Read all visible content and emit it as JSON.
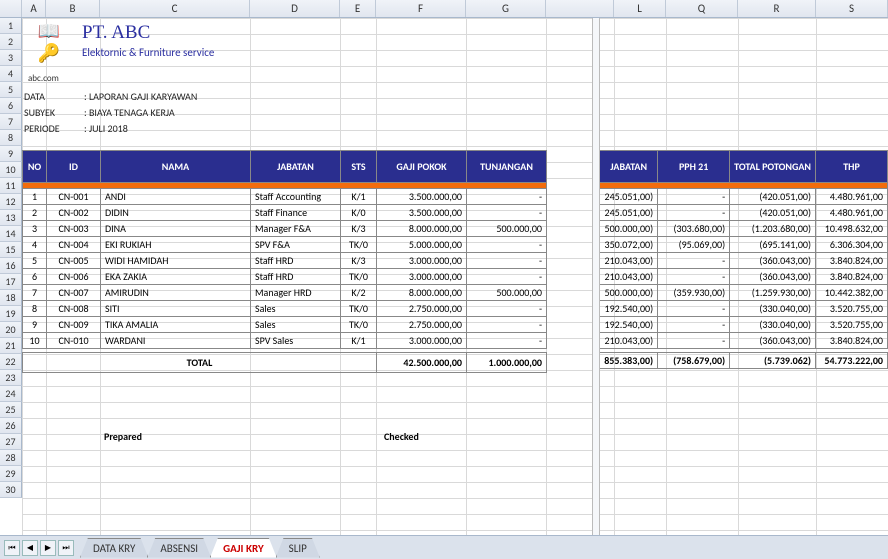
{
  "company": {
    "name": "PT. ABC",
    "tagline": "Elektornic & Furniture  service",
    "domain": "abc.com"
  },
  "meta": {
    "data_label": "DATA",
    "data_value": "LAPORAN GAJI KARYAWAN",
    "subyek_label": "SUBYEK",
    "subyek_value": "BIAYA TENAGA KERJA",
    "periode_label": "PERIODE",
    "periode_value": "JULI 2018"
  },
  "columns": [
    "NO",
    "ID",
    "NAMA",
    "JABATAN",
    "STS",
    "GAJI POKOK",
    "TUNJANGAN"
  ],
  "right_columns": [
    "JABATAN",
    "PPH 21",
    "TOTAL POTONGAN",
    "THP"
  ],
  "rows": [
    {
      "no": "1",
      "id": "CN-001",
      "nama": "ANDI",
      "jabatan": "Staff Accounting",
      "sts": "K/1",
      "gaji": "3.500.000,00",
      "tunj": "-",
      "jbt": "245.051,00)",
      "pph": "-",
      "pot": "(420.051,00)",
      "thp": "4.480.961,00"
    },
    {
      "no": "2",
      "id": "CN-002",
      "nama": "DIDIN",
      "jabatan": "Staff Finance",
      "sts": "K/0",
      "gaji": "3.500.000,00",
      "tunj": "-",
      "jbt": "245.051,00)",
      "pph": "-",
      "pot": "(420.051,00)",
      "thp": "4.480.961,00"
    },
    {
      "no": "3",
      "id": "CN-003",
      "nama": "DINA",
      "jabatan": "Manager F&A",
      "sts": "K/3",
      "gaji": "8.000.000,00",
      "tunj": "500.000,00",
      "jbt": "500.000,00)",
      "pph": "(303.680,00)",
      "pot": "(1.203.680,00)",
      "thp": "10.498.632,00"
    },
    {
      "no": "4",
      "id": "CN-004",
      "nama": "EKI RUKIAH",
      "jabatan": "SPV F&A",
      "sts": "TK/0",
      "gaji": "5.000.000,00",
      "tunj": "-",
      "jbt": "350.072,00)",
      "pph": "(95.069,00)",
      "pot": "(695.141,00)",
      "thp": "6.306.304,00"
    },
    {
      "no": "5",
      "id": "CN-005",
      "nama": "WIDI HAMIDAH",
      "jabatan": "Staff HRD",
      "sts": "K/3",
      "gaji": "3.000.000,00",
      "tunj": "-",
      "jbt": "210.043,00)",
      "pph": "-",
      "pot": "(360.043,00)",
      "thp": "3.840.824,00"
    },
    {
      "no": "6",
      "id": "CN-006",
      "nama": "EKA ZAKIA",
      "jabatan": "Staff HRD",
      "sts": "TK/0",
      "gaji": "3.000.000,00",
      "tunj": "-",
      "jbt": "210.043,00)",
      "pph": "-",
      "pot": "(360.043,00)",
      "thp": "3.840.824,00"
    },
    {
      "no": "7",
      "id": "CN-007",
      "nama": "AMIRUDIN",
      "jabatan": "Manager HRD",
      "sts": "K/2",
      "gaji": "8.000.000,00",
      "tunj": "500.000,00",
      "jbt": "500.000,00)",
      "pph": "(359.930,00)",
      "pot": "(1.259.930,00)",
      "thp": "10.442.382,00"
    },
    {
      "no": "8",
      "id": "CN-008",
      "nama": "SITI",
      "jabatan": "Sales",
      "sts": "TK/0",
      "gaji": "2.750.000,00",
      "tunj": "-",
      "jbt": "192.540,00)",
      "pph": "-",
      "pot": "(330.040,00)",
      "thp": "3.520.755,00"
    },
    {
      "no": "9",
      "id": "CN-009",
      "nama": "TIKA AMALIA",
      "jabatan": "Sales",
      "sts": "TK/0",
      "gaji": "2.750.000,00",
      "tunj": "-",
      "jbt": "192.540,00)",
      "pph": "-",
      "pot": "(330.040,00)",
      "thp": "3.520.755,00"
    },
    {
      "no": "10",
      "id": "CN-010",
      "nama": "WARDANI",
      "jabatan": "SPV Sales",
      "sts": "K/1",
      "gaji": "3.000.000,00",
      "tunj": "-",
      "jbt": "210.043,00)",
      "pph": "-",
      "pot": "(360.043,00)",
      "thp": "3.840.824,00"
    }
  ],
  "totals": {
    "label": "TOTAL",
    "gaji": "42.500.000,00",
    "tunj": "1.000.000,00",
    "jbt": "855.383,00)",
    "pph": "(758.679,00)",
    "pot": "(5.739.062)",
    "thp": "54.773.222,00"
  },
  "sign": {
    "prepared": "Prepared",
    "checked": "Checked"
  },
  "tabs": [
    "DATA KRY",
    "ABSENSI",
    "GAJI KRY",
    "SLIP"
  ],
  "active_tab": 2,
  "col_letters": [
    "A",
    "B",
    "C",
    "D",
    "E",
    "F",
    "G",
    "L",
    "Q",
    "R",
    "S"
  ],
  "row_numbers": [
    "1",
    "2",
    "3",
    "4",
    "5",
    "6",
    "7",
    "8",
    "9",
    "10",
    "11",
    "12",
    "13",
    "14",
    "15",
    "16",
    "17",
    "18",
    "19",
    "20",
    "21",
    "22",
    "23",
    "24",
    "25",
    "26",
    "27",
    "28",
    "29",
    "30"
  ]
}
